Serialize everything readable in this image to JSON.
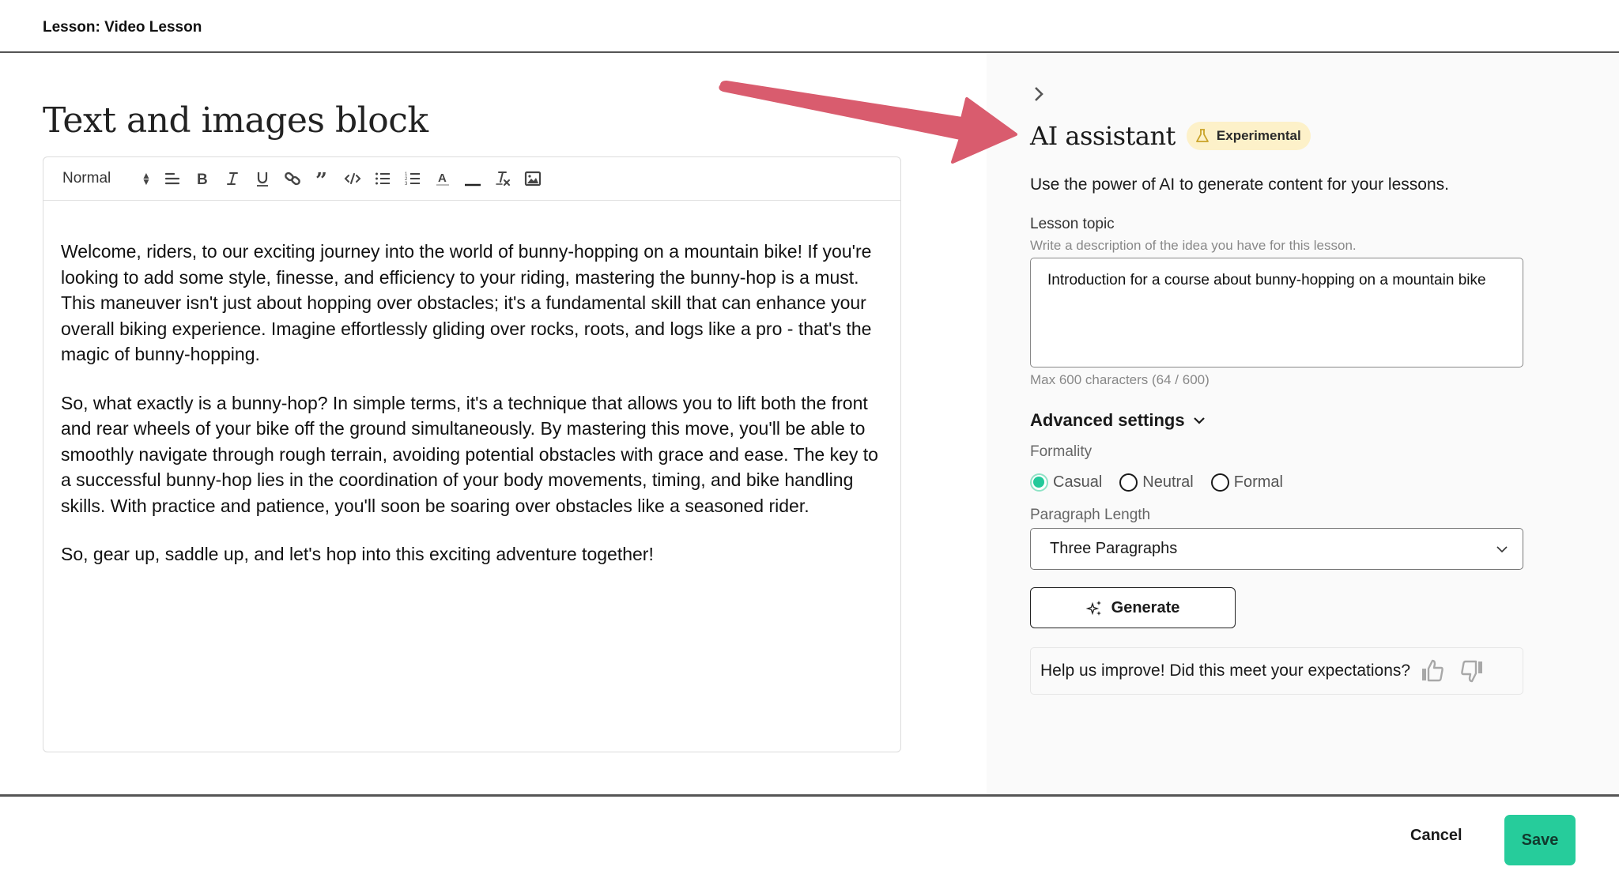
{
  "header": {
    "title": "Lesson: Video Lesson"
  },
  "editor": {
    "block_title": "Text and images block",
    "toolbar": {
      "format_value": "Normal",
      "buttons": [
        "align",
        "bold",
        "italic",
        "underline",
        "link",
        "blockquote",
        "code",
        "bullet-list",
        "ordered-list",
        "text-color",
        "horizontal-rule",
        "clear-formatting",
        "image"
      ]
    },
    "paragraphs": [
      "Welcome, riders, to our exciting journey into the world of bunny-hopping on a mountain bike! If you're looking to add some style, finesse, and efficiency to your riding, mastering the bunny-hop is a must. This maneuver isn't just about hopping over obstacles; it's a fundamental skill that can enhance your overall biking experience. Imagine effortlessly gliding over rocks, roots, and logs like a pro - that's the magic of bunny-hopping.",
      "So, what exactly is a bunny-hop? In simple terms, it's a technique that allows you to lift both the front and rear wheels of your bike off the ground simultaneously. By mastering this move, you'll be able to smoothly navigate through rough terrain, avoiding potential obstacles with grace and ease. The key to a successful bunny-hop lies in the coordination of your body movements, timing, and bike handling skills. With practice and patience, you'll soon be soaring over obstacles like a seasoned rider.",
      "So, gear up, saddle up, and let's hop into this exciting adventure together!"
    ]
  },
  "annotation": {
    "arrow_color": "#d95c6e"
  },
  "assistant": {
    "title": "AI assistant",
    "badge": "Experimental",
    "description": "Use the power of AI to generate content for your lessons.",
    "lesson_topic": {
      "label": "Lesson topic",
      "hint": "Write a description of the idea you have for this lesson.",
      "value": "Introduction for a course about bunny-hopping on a mountain bike",
      "counter": "Max 600 characters (64 / 600)"
    },
    "advanced_settings_label": "Advanced settings",
    "formality": {
      "label": "Formality",
      "options": [
        "Casual",
        "Neutral",
        "Formal"
      ],
      "selected": "Casual"
    },
    "paragraph_length": {
      "label": "Paragraph Length",
      "selected": "Three Paragraphs"
    },
    "generate_label": "Generate",
    "feedback_prompt": "Help us improve! Did this meet your expectations?"
  },
  "footer": {
    "cancel_label": "Cancel",
    "save_label": "Save"
  },
  "colors": {
    "accent": "#26cc9b",
    "badge_bg": "#fdf1c9",
    "panel_bg": "#fafafa"
  }
}
